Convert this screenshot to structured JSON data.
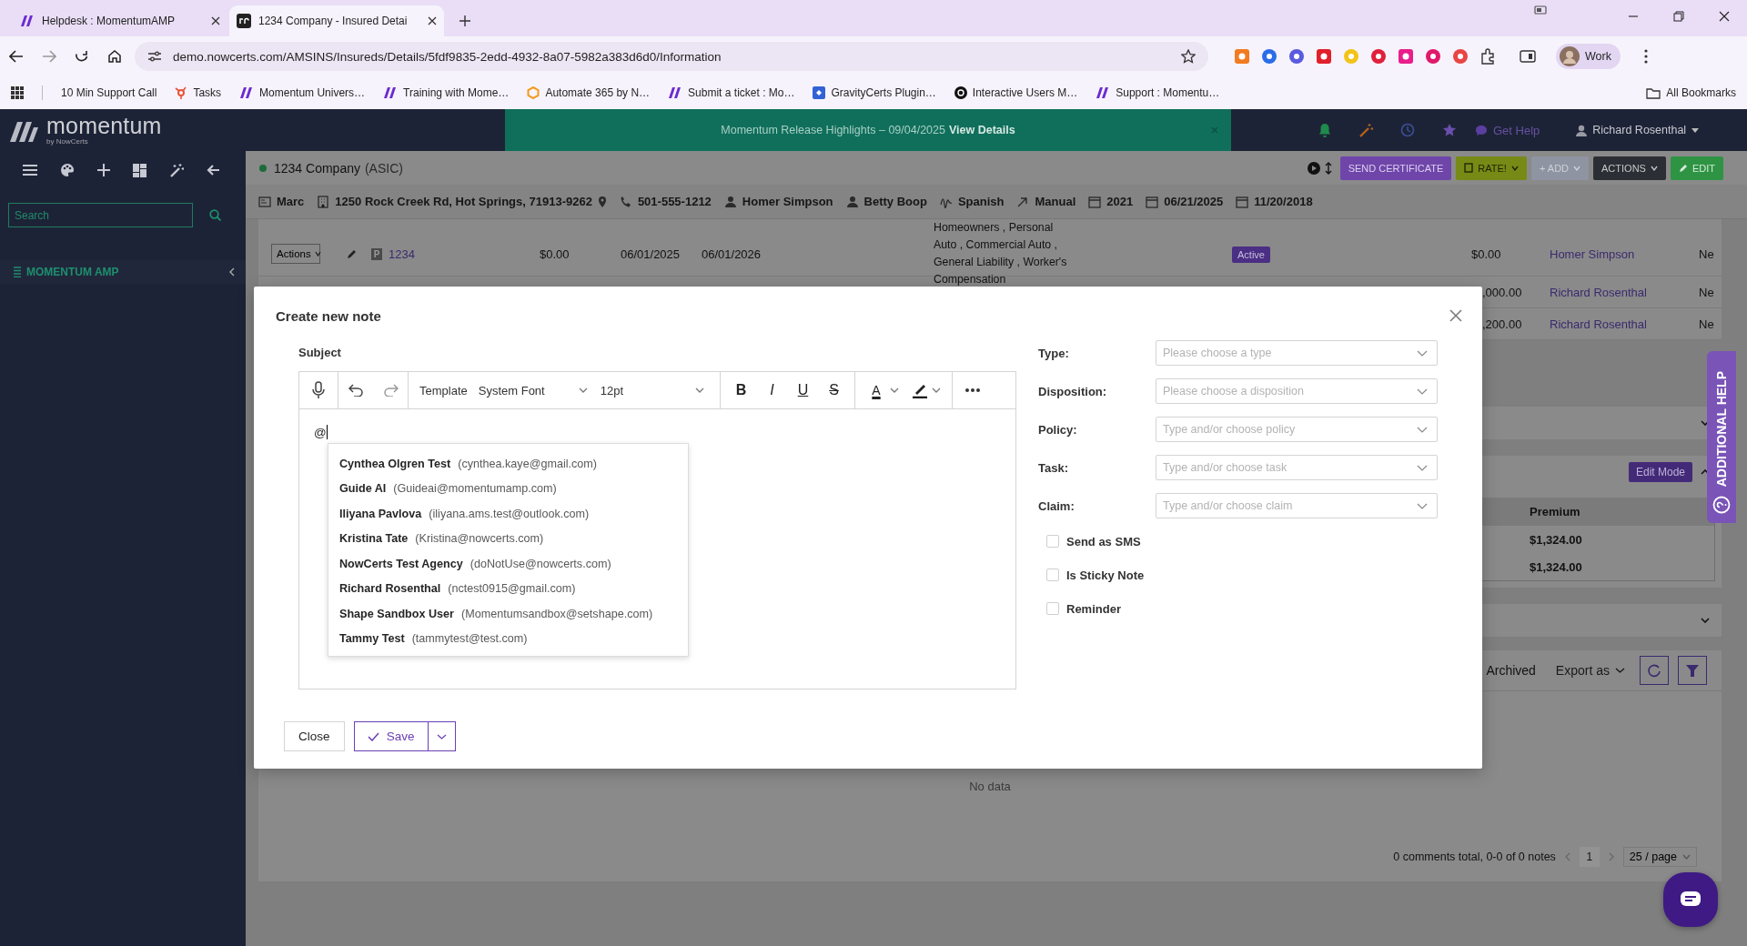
{
  "browser": {
    "tabs": [
      {
        "title": "Helpdesk : MomentumAMP",
        "selected": false
      },
      {
        "title": "1234 Company - Insured Detai",
        "selected": true
      }
    ],
    "url": "demo.nowcerts.com/AMSINS/Insureds/Details/5fdf9835-2edd-4932-8a07-5982a383d6d0/Information",
    "profile": "Work",
    "bookmarks": [
      "10 Min Support Call",
      "Tasks",
      "Momentum Univers…",
      "Training with Mome…",
      "Automate 365 by N…",
      "Submit a ticket : Mo…",
      "GravityCerts Plugin…",
      "Interactive Users M…",
      "Support : Momentu…"
    ],
    "all_bookmarks": "All Bookmarks"
  },
  "sidebar": {
    "logo": "momentum",
    "logo_tagline": "by NowCerts",
    "search_placeholder": "Search",
    "section": "MOMENTUM AMP"
  },
  "topbar": {
    "banner": "Momentum Release Highlights – 09/04/2025",
    "banner_link": "View Details",
    "get_help": "Get Help",
    "user": "Richard Rosenthal"
  },
  "record": {
    "name": "1234 Company",
    "code": "(ASIC)",
    "buttons": [
      {
        "label": "SEND CERTIFICATE",
        "kind": "certificate"
      },
      {
        "label": "RATE!",
        "kind": "rate"
      },
      {
        "label": "+ ADD",
        "kind": "add"
      },
      {
        "label": "ACTIONS",
        "kind": "actions"
      },
      {
        "label": "EDIT",
        "kind": "edit"
      }
    ],
    "info": [
      {
        "kind": "agent",
        "text": "Marc"
      },
      {
        "kind": "address",
        "text": "1250 Rock Creek Rd, Hot Springs, 71913-9262"
      },
      {
        "kind": "phone",
        "text": "501-555-1212"
      },
      {
        "kind": "person",
        "text": "Homer Simpson"
      },
      {
        "kind": "person",
        "text": "Betty Boop"
      },
      {
        "kind": "language",
        "text": "Spanish"
      },
      {
        "kind": "source",
        "text": "Manual"
      },
      {
        "kind": "date",
        "text": "2021"
      },
      {
        "kind": "date",
        "text": "06/21/2025"
      },
      {
        "kind": "date",
        "text": "11/20/2018"
      }
    ]
  },
  "policies": {
    "rows": [
      {
        "actions": "Actions",
        "badge": "P",
        "number": "1234",
        "amount": "$0.00",
        "effective": "06/01/2025",
        "expiration": "06/01/2026",
        "lines": "Homeowners , Personal Auto , Commercial Auto , General Liability , Worker's Compensation",
        "status": "Active",
        "premium": "$0.00",
        "agent": "Homer Simpson",
        "column_12": "Ne"
      }
    ],
    "partial_rows": [
      {
        "premium": ",000.00",
        "agent": "Richard Rosenthal",
        "column_12": "Ne"
      },
      {
        "premium": ",200.00",
        "agent": "Richard Rosenthal",
        "column_12": "Ne"
      }
    ]
  },
  "premium_panel": {
    "edit_mode": "Edit Mode",
    "column": "Premium",
    "rows": [
      "$1,324.00",
      "$1,324.00"
    ]
  },
  "notes": {
    "archived": "Archived",
    "export": "Export as",
    "empty": "No data",
    "summary": "0 comments total, 0-0 of 0 notes",
    "page": "1",
    "page_size": "25 / page"
  },
  "additional_help": "ADDITIONAL HELP",
  "modal": {
    "title": "Create new note",
    "subject_label": "Subject",
    "toolbar": {
      "template": "Template",
      "font": "System Font",
      "size": "12pt",
      "format": [
        {
          "kind": "bold",
          "label": "B"
        },
        {
          "kind": "italic",
          "label": "I"
        },
        {
          "kind": "underline",
          "label": "U"
        },
        {
          "kind": "strike",
          "label": "S"
        },
        {
          "kind": "text_color",
          "label": "A"
        }
      ]
    },
    "content": "@",
    "mentions": [
      {
        "name": "Cynthea Olgren Test",
        "email": "(cynthea.kaye@gmail.com)",
        "selected": false
      },
      {
        "name": "Guide AI",
        "email": "(Guideai@momentumamp.com)",
        "selected": false
      },
      {
        "name": "Iliyana Pavlova",
        "email": "(iliyana.ams.test@outlook.com)",
        "selected": false
      },
      {
        "name": "Kristina Tate",
        "email": "(Kristina@nowcerts.com)",
        "selected": false
      },
      {
        "name": "NowCerts Test Agency",
        "email": "(doNotUse@nowcerts.com)",
        "selected": false
      },
      {
        "name": "Richard Rosenthal",
        "email": "(nctest0915@gmail.com)",
        "selected": false
      },
      {
        "name": "Shape Sandbox User",
        "email": "(Momentumsandbox@setshape.com)",
        "selected": false
      },
      {
        "name": "Tammy Test",
        "email": "(tammytest@test.com)",
        "selected": false
      }
    ],
    "fields": [
      {
        "label": "Type:",
        "placeholder": "Please choose a type"
      },
      {
        "label": "Disposition:",
        "placeholder": "Please choose a disposition"
      },
      {
        "label": "Policy:",
        "placeholder": "Type and/or choose policy"
      },
      {
        "label": "Task:",
        "placeholder": "Type and/or choose task"
      },
      {
        "label": "Claim:",
        "placeholder": "Type and/or choose claim"
      }
    ],
    "checkboxes": [
      {
        "label": "Send as SMS",
        "checked": false
      },
      {
        "label": "Is Sticky Note",
        "checked": false
      },
      {
        "label": "Reminder",
        "checked": false
      }
    ],
    "buttons": {
      "close": "Close",
      "save": "Save"
    }
  }
}
